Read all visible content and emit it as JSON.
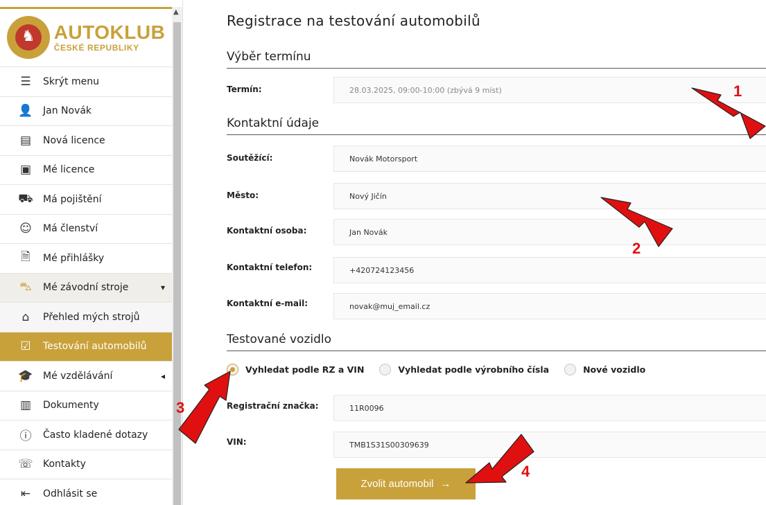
{
  "logo": {
    "line1": "AUTOKLUB",
    "line2": "ČESKÉ REPUBLIKY"
  },
  "menu": [
    {
      "icon": "menu-list-icon",
      "label": "Skrýt menu"
    },
    {
      "icon": "user-icon",
      "label": "Jan Novák"
    },
    {
      "icon": "new-license-icon",
      "label": "Nová licence"
    },
    {
      "icon": "license-card-icon",
      "label": "Mé licence"
    },
    {
      "icon": "insurance-icon",
      "label": "Má pojištění"
    },
    {
      "icon": "members-icon",
      "label": "Má členství"
    },
    {
      "icon": "document-icon",
      "label": "Mé přihlášky"
    },
    {
      "icon": "car-icon",
      "label": "Mé závodní stroje"
    },
    {
      "icon": "garage-icon",
      "label": "Přehled mých strojů"
    },
    {
      "icon": "checklist-icon",
      "label": "Testování automobilů"
    },
    {
      "icon": "graduation-cap-icon",
      "label": "Mé vzdělávání"
    },
    {
      "icon": "documents-icon",
      "label": "Dokumenty"
    },
    {
      "icon": "question-icon",
      "label": "Často kladené dotazy"
    },
    {
      "icon": "contacts-icon",
      "label": "Kontakty"
    },
    {
      "icon": "logout-icon",
      "label": "Odhlásit se"
    }
  ],
  "page": {
    "title": "Registrace na testování automobilů",
    "section1": "Výběr termínu",
    "section2": "Kontaktní údaje",
    "section3": "Testované vozidlo"
  },
  "fields": {
    "termin": {
      "label": "Termín:",
      "value": "28.03.2025, 09:00-10:00 (zbývá 9 míst)"
    },
    "soutezici": {
      "label": "Soutěžící:",
      "value": "Novák Motorsport"
    },
    "mesto": {
      "label": "Město:",
      "value": "Nový Jičín"
    },
    "osoba": {
      "label": "Kontaktní osoba:",
      "value": "Jan Novák"
    },
    "telefon": {
      "label": "Kontaktní telefon:",
      "value": "+420724123456"
    },
    "email": {
      "label": "Kontaktní e-mail:",
      "value": "novak@muj_email.cz"
    },
    "rz": {
      "label": "Registrační značka:",
      "value": "11R0096"
    },
    "vin": {
      "label": "VIN:",
      "value": "TMB1S31S00309639"
    }
  },
  "radios": [
    {
      "label": "Vyhledat podle RZ a VIN",
      "selected": true
    },
    {
      "label": "Vyhledat podle výrobního čísla",
      "selected": false
    },
    {
      "label": "Nové vozidlo",
      "selected": false
    }
  ],
  "button": {
    "label": "Zvolit automobil",
    "arrow": "→"
  },
  "annotations": [
    "1",
    "2",
    "3",
    "4"
  ],
  "colors": {
    "accent": "#c9a13a",
    "annotation": "#e01010"
  }
}
